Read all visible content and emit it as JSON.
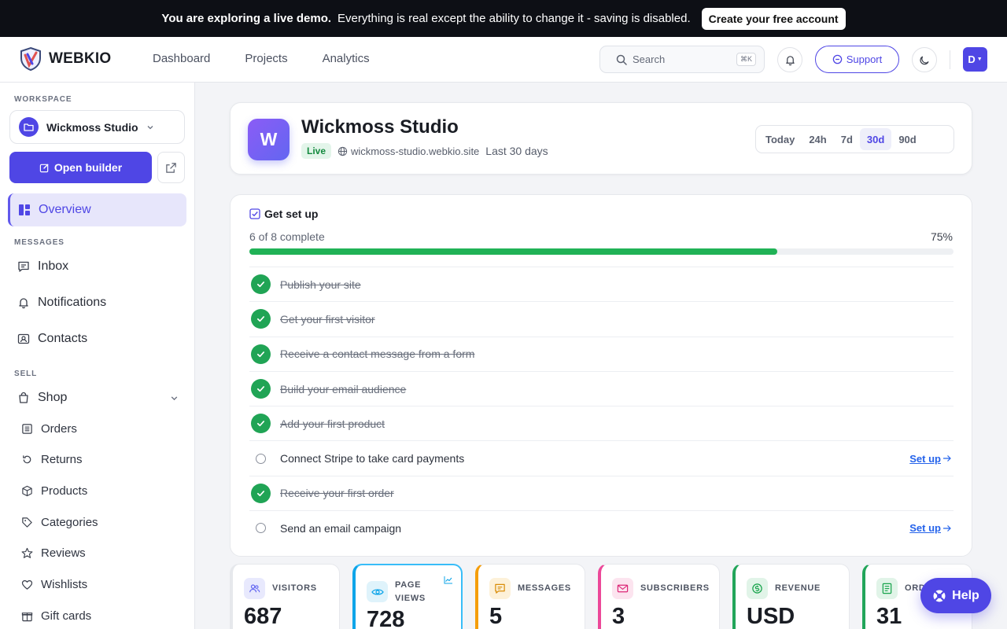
{
  "banner": {
    "strong": "You are exploring a live demo.",
    "text": "Everything is real except the ability to change it - saving is disabled.",
    "cta": "Create your free account"
  },
  "header": {
    "logo": "WEBKIO",
    "nav": [
      "Dashboard",
      "Projects",
      "Analytics"
    ],
    "search_placeholder": "Search",
    "search_shortcut": "⌘K",
    "support": "Support",
    "avatar": "D"
  },
  "sidebar": {
    "workspace_label": "WORKSPACE",
    "workspace_name": "Wickmoss Studio",
    "open_builder": "Open builder",
    "overview": "Overview",
    "messages_label": "MESSAGES",
    "messages": [
      "Inbox",
      "Notifications",
      "Contacts"
    ],
    "sell_label": "SELL",
    "shop": "Shop",
    "shop_items": [
      "Orders",
      "Returns",
      "Products",
      "Categories",
      "Reviews",
      "Wishlists",
      "Gift cards"
    ]
  },
  "site": {
    "initial": "W",
    "name": "Wickmoss Studio",
    "status": "Live",
    "url": "wickmoss-studio.webkio.site",
    "period": "Last 30 days",
    "ranges": [
      "Today",
      "24h",
      "7d",
      "30d",
      "90d"
    ],
    "active_range": "30d"
  },
  "setup": {
    "title": "Get set up",
    "progress_text": "6 of 8 complete",
    "progress_pct": "75%",
    "progress_value": 0.75,
    "tasks": [
      {
        "label": "Publish your site",
        "done": true
      },
      {
        "label": "Get your first visitor",
        "done": true
      },
      {
        "label": "Receive a contact message from a form",
        "done": true
      },
      {
        "label": "Build your email audience",
        "done": true
      },
      {
        "label": "Add your first product",
        "done": true
      },
      {
        "label": "Connect Stripe to take card payments",
        "done": false,
        "action": "Set up"
      },
      {
        "label": "Receive your first order",
        "done": true
      },
      {
        "label": "Send an email campaign",
        "done": false,
        "action": "Set up"
      }
    ]
  },
  "stats": [
    {
      "label": "VISITORS",
      "value": "687",
      "color": "#6366f1"
    },
    {
      "label": "PAGE VIEWS",
      "value": "728",
      "color": "#0ea5e9"
    },
    {
      "label": "MESSAGES",
      "value": "5",
      "color": "#f59e0b"
    },
    {
      "label": "SUBSCRIBERS",
      "value": "3",
      "color": "#ec4899"
    },
    {
      "label": "REVENUE",
      "value": "USD",
      "color": "#22a55a"
    },
    {
      "label": "ORDERS",
      "value": "31",
      "color": "#22a55a"
    }
  ],
  "help": "Help"
}
